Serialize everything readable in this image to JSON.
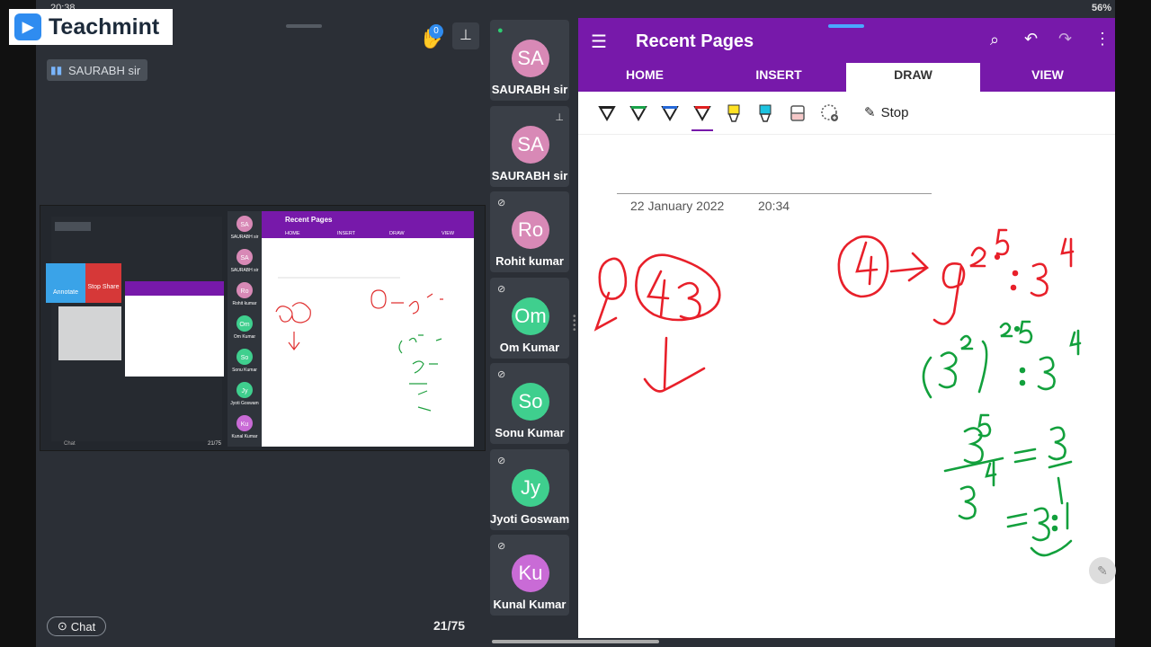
{
  "status": {
    "time": "20:38",
    "right": "56%"
  },
  "app": {
    "logo_text": "Teachmint"
  },
  "host": {
    "label": "SAURABH sir"
  },
  "raise_hand": {
    "count": "0"
  },
  "footer": {
    "chat_label": "Chat",
    "page_counter": "21/75"
  },
  "participants": [
    {
      "initials": "SA",
      "name": "SAURABH sir",
      "color": "#d889b6"
    },
    {
      "initials": "SA",
      "name": "SAURABH sir",
      "color": "#d889b6"
    },
    {
      "initials": "Ro",
      "name": "Rohit kumar",
      "color": "#d889b6"
    },
    {
      "initials": "Om",
      "name": "Om Kumar",
      "color": "#3fcf8e"
    },
    {
      "initials": "So",
      "name": "Sonu Kumar",
      "color": "#3fcf8e"
    },
    {
      "initials": "Jy",
      "name": "Jyoti Goswam",
      "color": "#3fcf8e"
    },
    {
      "initials": "Ku",
      "name": "Kunal Kumar",
      "color": "#c96bd6"
    }
  ],
  "onenote": {
    "title": "Recent Pages",
    "tabs": [
      "HOME",
      "INSERT",
      "DRAW",
      "VIEW"
    ],
    "active_tab": "DRAW",
    "stop_label": "Stop",
    "note_date": "22 January 2022",
    "note_time": "20:34",
    "accent": "#7719aa"
  },
  "mini_share": {
    "title": "Recent Pages",
    "tabs": [
      "HOME",
      "INSERT",
      "DRAW",
      "VIEW"
    ],
    "annotate": "Annotate",
    "stop_share": "Stop Share",
    "page": "21/75",
    "chat": "Chat",
    "names": [
      "SAURABH sir",
      "SAURABH sir",
      "Rohit kumar",
      "Om Kumar",
      "Sonu Kumar",
      "Jyoti Goswam",
      "Kunal Kumar"
    ],
    "initials": [
      "SA",
      "SA",
      "Ro",
      "Om",
      "So",
      "Jy",
      "Ku"
    ]
  }
}
